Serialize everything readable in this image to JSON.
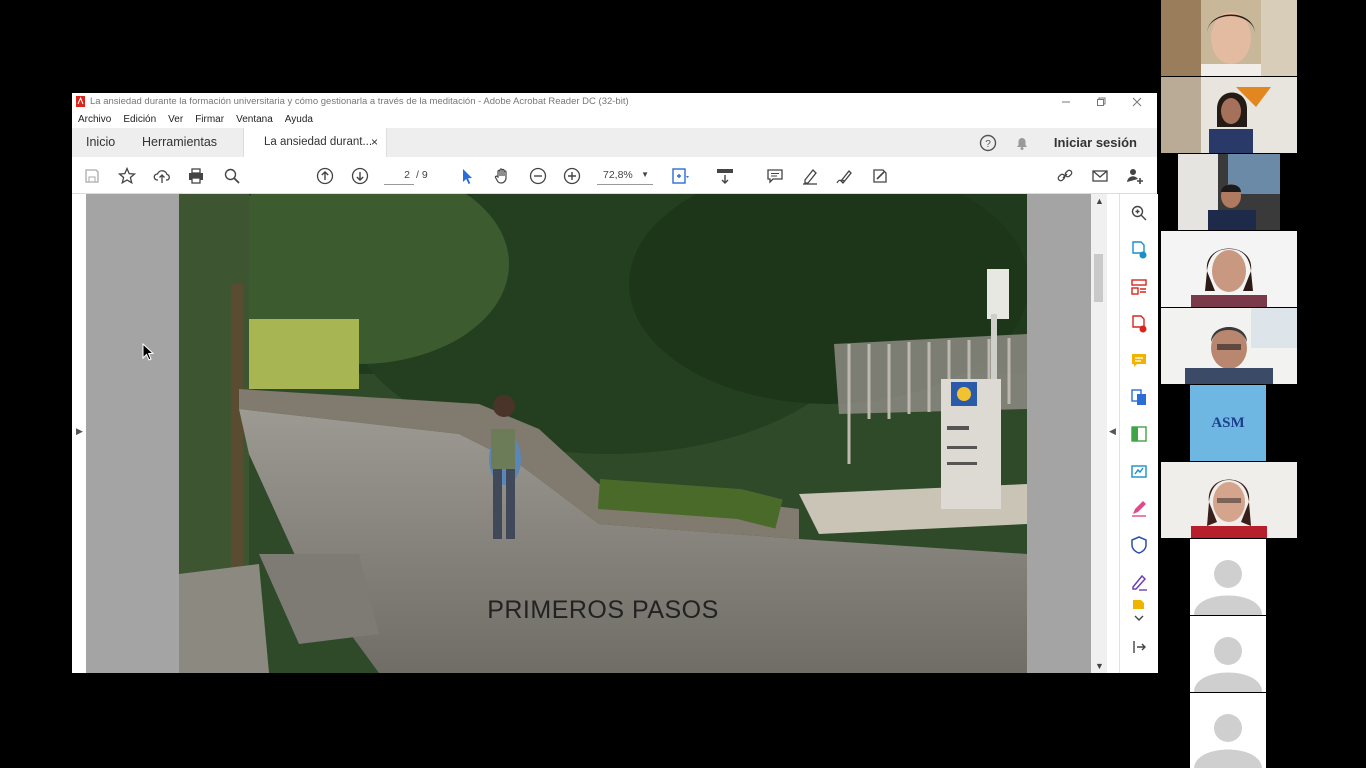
{
  "window": {
    "title": "La ansiedad durante la formación universitaria y cómo gestionarla a través de la meditación - Adobe Acrobat Reader DC (32-bit)"
  },
  "menu": [
    "Archivo",
    "Edición",
    "Ver",
    "Firmar",
    "Ventana",
    "Ayuda"
  ],
  "tabs": {
    "home": "Inicio",
    "tools": "Herramientas",
    "document": "La ansiedad durant...",
    "close": "×"
  },
  "signin": "Iniciar sesión",
  "toolbar": {
    "page_current": "2",
    "page_total": "/ 9",
    "zoom": "72,8%"
  },
  "slide": {
    "caption": "PRIMEROS PASOS",
    "sign_logo": "ASM"
  },
  "participants": [
    {
      "type": "video",
      "label": "participant-1"
    },
    {
      "type": "video",
      "label": "participant-2"
    },
    {
      "type": "video",
      "label": "participant-3"
    },
    {
      "type": "video",
      "label": "participant-4"
    },
    {
      "type": "video",
      "label": "participant-5"
    },
    {
      "type": "logo",
      "text": "ASM"
    },
    {
      "type": "video",
      "label": "participant-7"
    },
    {
      "type": "avatar"
    },
    {
      "type": "avatar"
    },
    {
      "type": "avatar"
    }
  ],
  "colors": {
    "acrobat_red": "#d9261c",
    "select_blue": "#2b6dd6",
    "asm_blue": "#6fb7e3"
  }
}
